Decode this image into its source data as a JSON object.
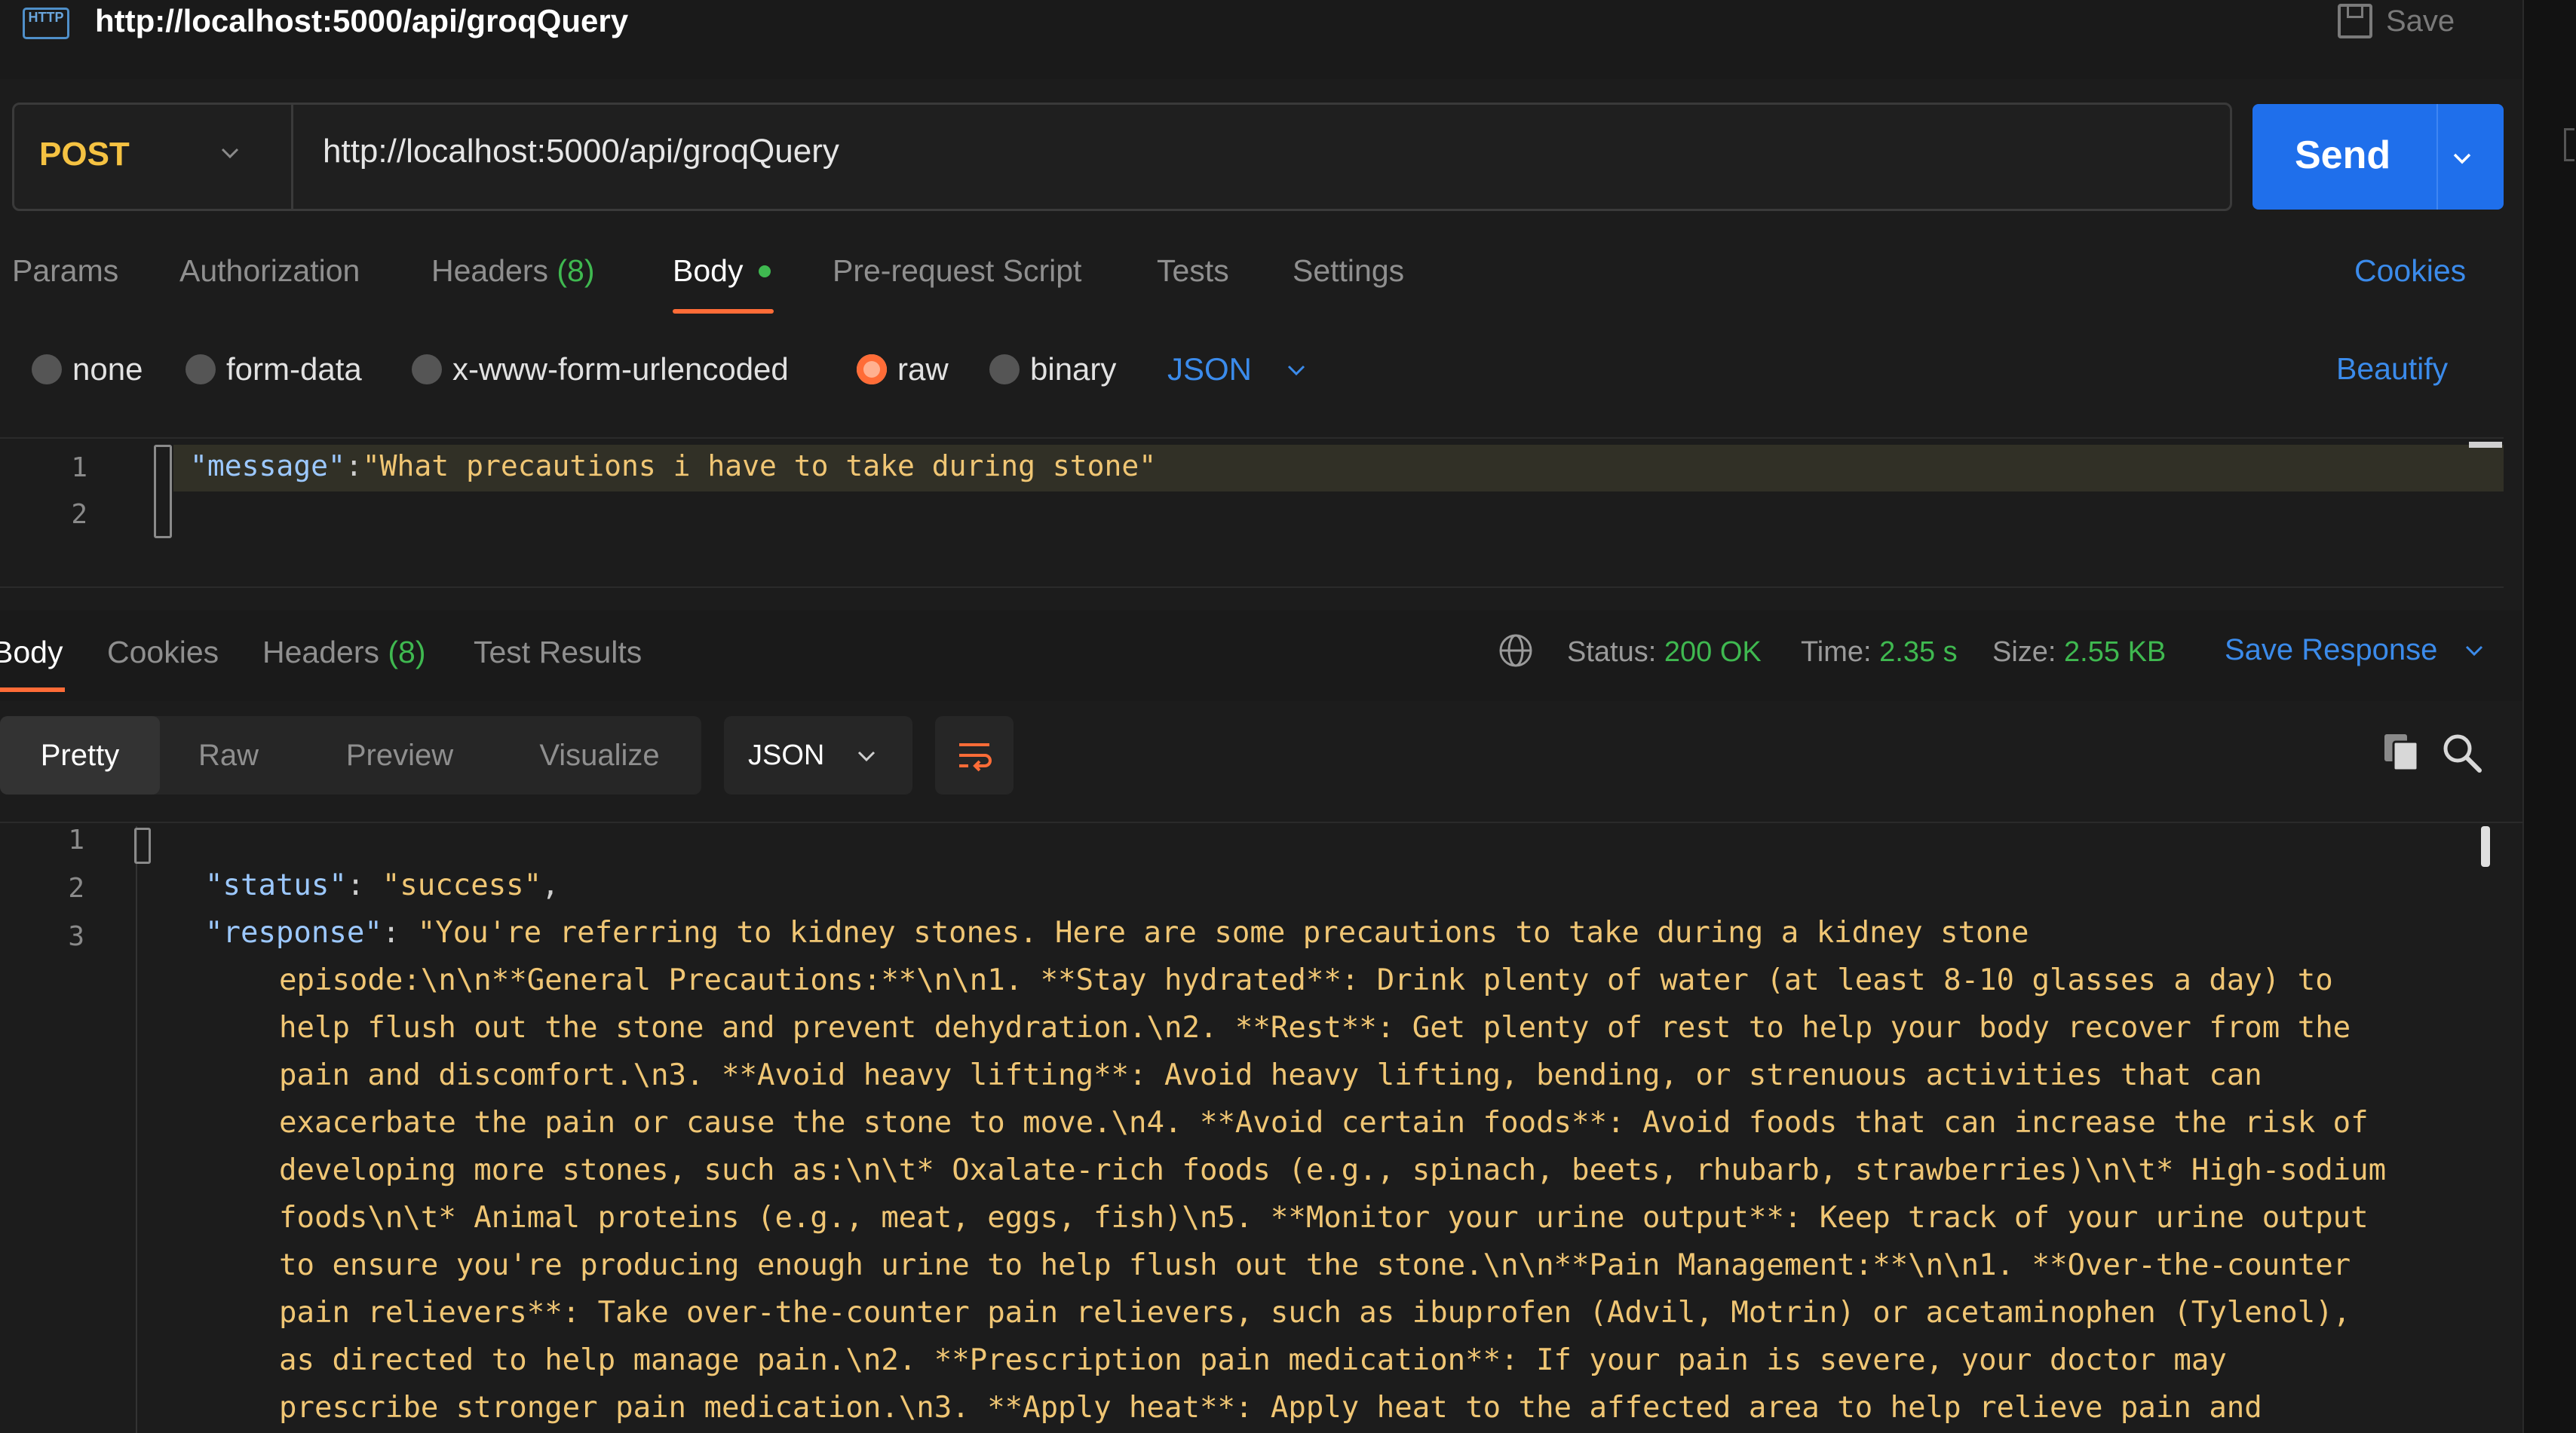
{
  "request": {
    "title": "http://localhost:5000/api/groqQuery",
    "save_label": "Save",
    "method": "POST",
    "url": "http://localhost:5000/api/groqQuery",
    "send_label": "Send"
  },
  "request_tabs": {
    "params": "Params",
    "authorization": "Authorization",
    "headers": "Headers",
    "headers_count": "(8)",
    "body": "Body",
    "pre_request": "Pre-request Script",
    "tests": "Tests",
    "settings": "Settings",
    "cookies": "Cookies"
  },
  "body_types": {
    "none": "none",
    "form_data": "form-data",
    "urlencoded": "x-www-form-urlencoded",
    "raw": "raw",
    "binary": "binary",
    "format": "JSON",
    "beautify": "Beautify",
    "selected": "raw"
  },
  "request_body": {
    "line_numbers": [
      "1",
      "2"
    ],
    "key": "\"message\"",
    "colon": ":",
    "value": "\"What precautions i have to take during stone\""
  },
  "response_tabs": {
    "body": "Body",
    "cookies": "Cookies",
    "headers": "Headers",
    "headers_count": "(8)",
    "test_results": "Test Results",
    "status_label": "Status:",
    "status_value": "200 OK",
    "time_label": "Time:",
    "time_value": "2.35 s",
    "size_label": "Size:",
    "size_value": "2.55 KB",
    "save_response": "Save Response"
  },
  "response_view": {
    "pretty": "Pretty",
    "raw": "Raw",
    "preview": "Preview",
    "visualize": "Visualize",
    "format": "JSON"
  },
  "response_body": {
    "line_numbers": [
      "1",
      "2",
      "3"
    ],
    "status_key": "\"status\"",
    "status_value": "\"success\"",
    "response_key": "\"response\"",
    "lines": [
      "\"You're referring to kidney stones. Here are some precautions to take during a kidney stone",
      "episode:\\n\\n**General Precautions:**\\n\\n1. **Stay hydrated**: Drink plenty of water (at least 8-10 glasses a day) to",
      "help flush out the stone and prevent dehydration.\\n2. **Rest**: Get plenty of rest to help your body recover from the",
      "pain and discomfort.\\n3. **Avoid heavy lifting**: Avoid heavy lifting, bending, or strenuous activities that can",
      "exacerbate the pain or cause the stone to move.\\n4. **Avoid certain foods**: Avoid foods that can increase the risk of",
      "developing more stones, such as:\\n\\t* Oxalate-rich foods (e.g., spinach, beets, rhubarb, strawberries)\\n\\t* High-sodium",
      "foods\\n\\t* Animal proteins (e.g., meat, eggs, fish)\\n5. **Monitor your urine output**: Keep track of your urine output",
      "to ensure you're producing enough urine to help flush out the stone.\\n\\n**Pain Management:**\\n\\n1. **Over-the-counter",
      "pain relievers**: Take over-the-counter pain relievers, such as ibuprofen (Advil, Motrin) or acetaminophen (Tylenol),",
      "as directed to help manage pain.\\n2. **Prescription pain medication**: If your pain is severe, your doctor may",
      "prescribe stronger pain medication.\\n3. **Apply heat**: Apply heat to the affected area to help relieve pain and"
    ]
  },
  "colors": {
    "accent": "#ff6c37",
    "send": "#1f6feb",
    "method": "#f5c242",
    "status_ok": "#3fb950",
    "link": "#3b8beb"
  },
  "icons": {
    "http": "http-icon",
    "save": "save-icon",
    "globe": "globe-icon",
    "wrap": "wrap-lines-icon",
    "copy": "copy-icon",
    "search": "search-icon"
  }
}
